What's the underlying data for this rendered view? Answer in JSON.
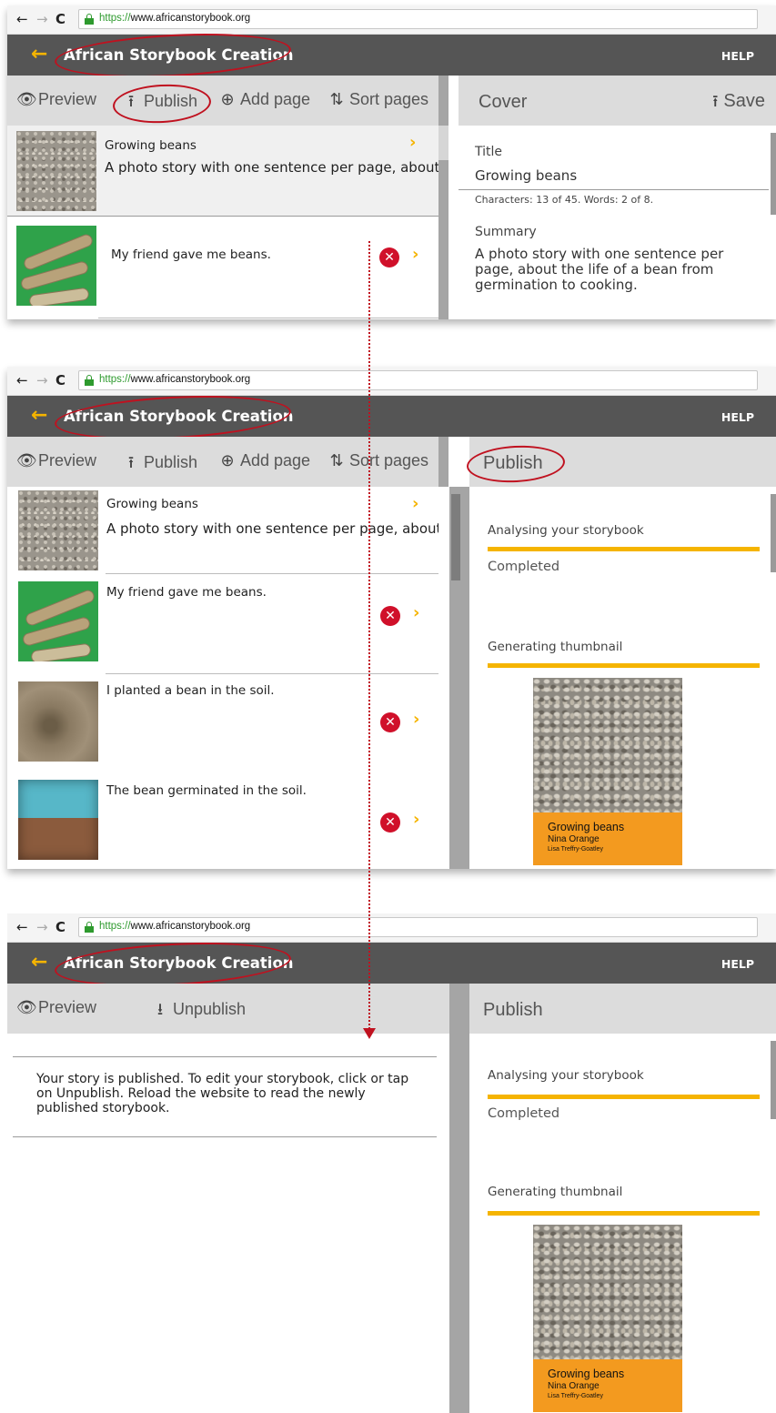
{
  "browser": {
    "back": "←",
    "forward": "→",
    "reload": "C",
    "url_scheme": "https://",
    "url_host": "www.africanstorybook.org"
  },
  "app": {
    "back_arrow": "←",
    "title": "African Storybook Creation",
    "help": "HELP"
  },
  "toolbar": {
    "preview": "Preview",
    "publish": "Publish",
    "add_page": "Add page",
    "sort_pages": "Sort pages",
    "unpublish": "Unpublish"
  },
  "icons": {
    "preview": "eye-icon",
    "publish": "upload-icon",
    "add_page": "plus-circle-icon",
    "sort_pages": "sort-icon",
    "save": "upload-icon",
    "unpublish": "download-icon",
    "delete": "close-circle-icon",
    "open": "chevron-right-icon",
    "secure": "lock-icon"
  },
  "icon_glyphs": {
    "eye": "👁",
    "upload": "⭱",
    "plus": "⊕",
    "sort": "⇅",
    "download": "⭳",
    "close": "✕",
    "chevron": "›"
  },
  "pages": [
    {
      "title": "Growing beans",
      "subtitle": "A photo story with one sentence per page, about..."
    },
    {
      "text": "My friend gave me beans."
    },
    {
      "text": "I planted a bean in the soil."
    },
    {
      "text": "The bean germinated in the soil."
    }
  ],
  "cover_editor": {
    "heading": "Cover",
    "save": "Save",
    "title_label": "Title",
    "title_value": "Growing beans",
    "counts": "Characters: 13 of 45. Words: 2 of 8.",
    "summary_label": "Summary",
    "summary_value": "A photo story with one sentence per page, about the life of a bean from germination to cooking."
  },
  "publish_pane": {
    "heading": "Publish",
    "step1_label": "Analysing your storybook",
    "step1_status": "Completed",
    "step2_label": "Generating thumbnail"
  },
  "cover_thumb": {
    "title": "Growing beans",
    "author": "Nina Orange",
    "illustrator": "Lisa Treffry-Goatley"
  },
  "published_message": "Your story is published. To edit your storybook, click or tap on Unpublish. Reload the website to read the newly published storybook.",
  "colors": {
    "accent": "#f5b400",
    "appbar": "#555555",
    "annotation": "#c0111f",
    "delete": "#d0102a",
    "cover_band": "#f39a1f"
  }
}
